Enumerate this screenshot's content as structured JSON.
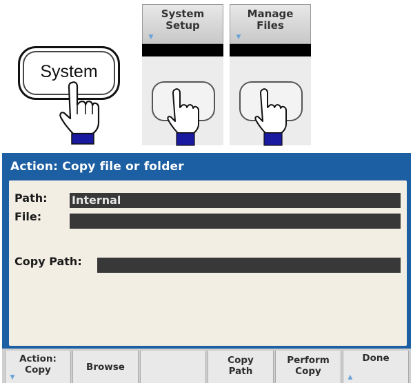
{
  "physical_button": {
    "label": "System"
  },
  "soft_keys": [
    {
      "label": "System\nSetup",
      "arrow": "down-arrow"
    },
    {
      "label": "Manage\nFiles",
      "arrow": "down-arrow"
    }
  ],
  "dialog": {
    "title": "Action: Copy file or folder",
    "fields": {
      "path": {
        "label": "Path:",
        "value": "Internal"
      },
      "file": {
        "label": "File:",
        "value": ""
      },
      "copy_path": {
        "label": "Copy Path:",
        "value": ""
      }
    }
  },
  "menu": [
    {
      "label": "Action:\nCopy",
      "arrow": "down-arrow"
    },
    {
      "label": "Browse"
    },
    {
      "label": ""
    },
    {
      "label": "Copy\nPath"
    },
    {
      "label": "Perform\nCopy"
    },
    {
      "label": "Done",
      "arrow": "up-arrow"
    }
  ]
}
